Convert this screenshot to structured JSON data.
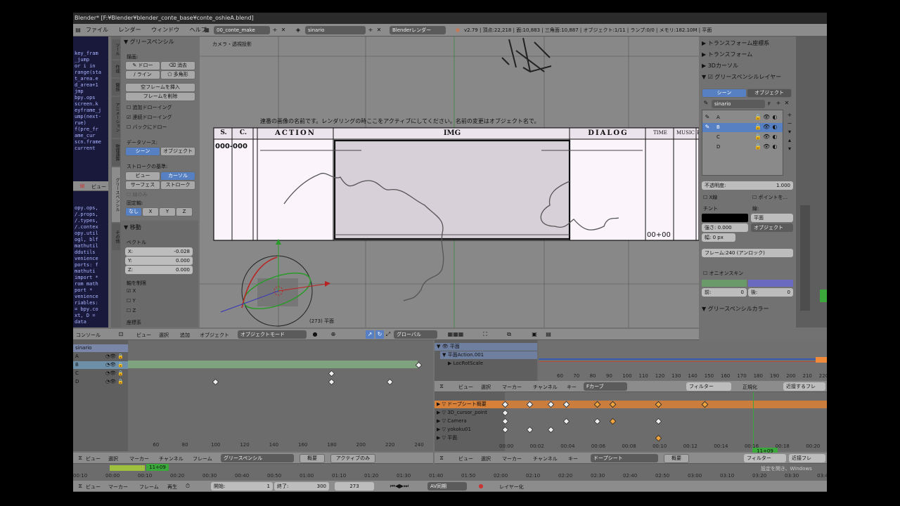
{
  "titlebar": {
    "text": "Blender* [F:¥Blender¥blender_conte_base¥conte_oshieA.blend]"
  },
  "topbar": {
    "menus": [
      "ファイル",
      "レンダー",
      "ウィンドウ",
      "ヘルプ"
    ],
    "screen": "00_conte_make",
    "scene": "sinario",
    "engine": "Blenderレンダー",
    "stats": "v2.79 | 頂点:22,218 | 面:10,883 | 三角面:10,887 | オブジェクト:1/11 | ランプ:0/0 | メモリ:182.10M | 平面"
  },
  "console_left": {
    "lines": [
      "key_fram",
      "_jump",
      "or i in",
      "range(sta",
      "t_area.e",
      "d_area+1",
      "",
      "jmp",
      "bpy.ops",
      "screen.k",
      "eyframe_j",
      "ump(next-",
      "rue)",
      "",
      "f(pre_fr",
      "ame_cur",
      "",
      "scn.frame",
      "current"
    ],
    "lines2": [
      "opy.ops,",
      "/.props,",
      "/.types,",
      "/.contex",
      "opy.util",
      "ogl, blf",
      "mathutil",
      "ddutils",
      "venience",
      "ports: f",
      "mathuti",
      "import *",
      "rom math",
      "port *",
      "venience",
      "riables:",
      "= bpy.co",
      "xt, D =",
      "data"
    ],
    "header": "ビュー"
  },
  "toolshelf": {
    "title": "グリースペンシル",
    "draw_label": "描画:",
    "draw_btn": "ドロー",
    "erase_btn": "消去",
    "line_btn": "ライン",
    "poly_btn": "多角形",
    "insert_blank": "空フレームを挿入",
    "delete_frame": "フレームを削除",
    "add_drawing": "追加ドローイング",
    "continuous_drawing": "連続ドローイング",
    "back_draw": "バックにドロー",
    "datasource_label": "データソース:",
    "scene_btn": "シーン",
    "object_btn": "オブジェクト",
    "stroke_label": "ストロークの基準:",
    "view_btn": "ビュー",
    "cursor_btn": "カーソル",
    "surface_btn": "サーフェス",
    "stroke_btn": "ストローク",
    "only_label": "線のみ",
    "axis_label": "固定軸:",
    "none_btn": "なし",
    "x_btn": "X",
    "y_btn": "Y",
    "z_btn": "Z",
    "move_title": "移動",
    "vector_label": "ベクトル",
    "vx": "X:",
    "vx_val": "-0.028",
    "vy": "Y:",
    "vy_val": "0.000",
    "vz": "Z:",
    "vz_val": "0.000",
    "constraint_label": "軸を制限",
    "cx": "X",
    "cy": "Y",
    "cz": "Z",
    "orient_label": "座標系",
    "tabs": [
      "ツール",
      "作成",
      "関係",
      "アニメーション",
      "物理演算",
      "グリースペンシル",
      "その他"
    ]
  },
  "viewport": {
    "title": "カメラ・透視投影",
    "banner": "連番の画像の名前です。レンダリングの時ここをアクティブにしてください。名前の変更はオブジェクト名で。",
    "headers": [
      "S.",
      "C.",
      "ACTION",
      "IMG",
      "DIALOG",
      "TIME",
      "MUSIC",
      "E"
    ],
    "sc": "000-000",
    "time": "00+00",
    "obj_label": "(273) 平面",
    "header_menus": [
      "ビュー",
      "選択",
      "追加",
      "オブジェクト"
    ],
    "mode": "オブジェクトモード",
    "orientation": "グローバル",
    "console_tab": "コンソール"
  },
  "properties": {
    "transform_coords": "トランスフォーム座標系",
    "transform": "トランスフォーム",
    "cursor3d": "3Dカーソル",
    "gp_layers": "グリースペンシルレイヤー",
    "scene_tab": "シーン",
    "object_tab": "オブジェクト",
    "gp_name": "sinario",
    "gp_f": "F",
    "layers": [
      "A",
      "B",
      "C",
      "D"
    ],
    "opacity_label": "不透明度:",
    "opacity_val": "1.000",
    "xray": "X線",
    "show_points": "ポイントを...",
    "tint_label": "チント",
    "thickness_label": "線:",
    "strength": "強さ: 0.000",
    "plane": "平面",
    "object_dd": "オブジェクト",
    "thick_val": "幅: 0 px",
    "frame_label": "フレーム:240 (アンロック)",
    "onion": "オニオンスキン",
    "before": "前:",
    "before_val": "0",
    "after": "後:",
    "after_val": "0",
    "gp_colors": "グリースペンシルカラー"
  },
  "dopesheet_left": {
    "channel_title": "sinario",
    "channels": [
      "A",
      "B",
      "C",
      "D"
    ],
    "ticks": [
      "60",
      "80",
      "100",
      "120",
      "140",
      "160",
      "180",
      "200",
      "220",
      "240"
    ],
    "header_menus": [
      "ビュー",
      "選択",
      "マーカー",
      "チャンネル",
      "フレーム"
    ],
    "mode": "グリースペンシル",
    "summary": "概要",
    "only_active": "アクティブのみ"
  },
  "graph_right": {
    "channels": [
      "平面",
      "平面Action.001",
      "LocRotScale"
    ],
    "ticks": [
      "60",
      "70",
      "80",
      "90",
      "100",
      "110",
      "120",
      "130",
      "140",
      "150",
      "160",
      "170",
      "180",
      "190",
      "200",
      "210",
      "220"
    ],
    "header_menus": [
      "ビュー",
      "選択",
      "マーカー",
      "チャンネル",
      "キー"
    ],
    "fcurve": "Fカーブ",
    "filter": "フィルター",
    "normalize": "正規化",
    "nearest": "近接するフレ"
  },
  "dopesheet_right": {
    "channels": [
      "ドープシート概要",
      "3D_cursor_point",
      "Camera",
      "yokoku01",
      "平面"
    ],
    "ticks": [
      "00:00",
      "00:02",
      "00:04",
      "00:06",
      "00:08",
      "00:10",
      "00:12",
      "00:14",
      "00:16",
      "00:18",
      "00:20"
    ],
    "current": "11+09",
    "header_menus": [
      "ビュー",
      "選択",
      "マーカー",
      "チャンネル",
      "キー"
    ],
    "mode": "ドープシート",
    "summary": "概要",
    "filter": "フィルター",
    "nearest": "近接フレ"
  },
  "timeline": {
    "current": "11+09",
    "ticks": [
      "00:10",
      "00:00",
      "00:10",
      "00:20",
      "00:30",
      "00:40",
      "00:50",
      "01:00",
      "01:10",
      "01:20",
      "01:30",
      "01:40",
      "01:50",
      "02:00",
      "02:10",
      "02:20",
      "02:30",
      "02:40",
      "02:50",
      "03:00",
      "03:10",
      "03:20",
      "03:30",
      "03:40"
    ],
    "menus": [
      "ビュー",
      "マーカー",
      "フレーム",
      "再生"
    ],
    "start_label": "開始:",
    "start_val": "1",
    "end_label": "終了:",
    "end_val": "300",
    "frame_val": "273",
    "sync": "AV同期",
    "keying": "レイヤー化"
  },
  "watermark": "設定を開き、Windows"
}
